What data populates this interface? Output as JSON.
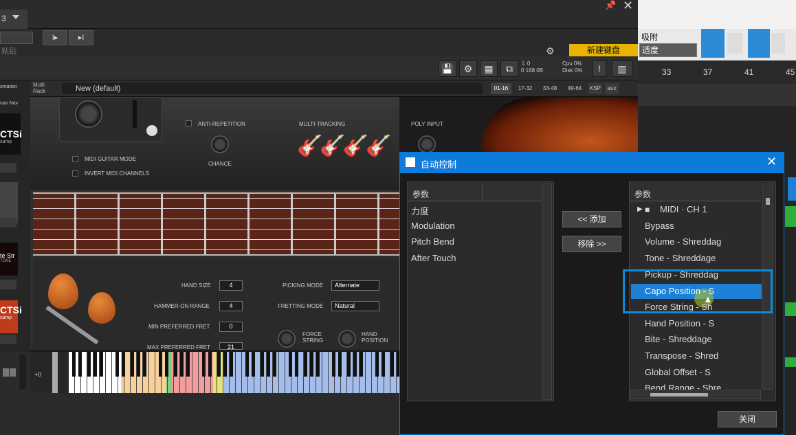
{
  "top": {
    "track_num": "3",
    "paste": "粘贴"
  },
  "toolbar": {
    "new_keyboard": "新建键盘",
    "btn1": "I▸",
    "btn2": "▸I"
  },
  "snap": {
    "label": "吸附",
    "value": "适度"
  },
  "ruler": [
    "33",
    "37",
    "41",
    "45"
  ],
  "kontakt": {
    "mem_line1": "⇩ 0",
    "mem_line2": "0 168 0B",
    "cpu_line1": "Cpu  0%",
    "cpu_line2": "Disk 0%",
    "multi_line1": "Multi",
    "multi_line2": "Rack",
    "preset": "New (default)",
    "ranges": [
      "01-16",
      "17-32",
      "33-48",
      "49-64",
      "KSP",
      "aux"
    ]
  },
  "leftstrip": {
    "automation": "omation",
    "instr": "nstr Nav",
    "ctsi1": "CTSi",
    "samp1": "samp",
    "ctsi2": "te Str",
    "tone": "TONE",
    "ctsi3": "CTSi",
    "samp3": "samp"
  },
  "instrument": {
    "midi_guitar_mode": "MIDI GUITAR MODE",
    "invert_midi": "INVERT MIDI CHANNELS",
    "anti_repetition": "ANTI-REPETITION",
    "chance": "CHANCE",
    "multi_tracking": "MULTI-TRACKING",
    "poly_input": "POLY INPUT",
    "hand_size_label": "HAND SIZE",
    "hand_size": "4",
    "hammer_on_label": "HAMMER-ON RANGE",
    "hammer_on": "4",
    "min_fret_label": "MIN PREFERRED FRET",
    "min_fret": "0",
    "max_fret_label": "MAX PREFERRED FRET",
    "max_fret": "21",
    "picking_mode_label": "PICKING MODE",
    "picking_mode": "Alternate",
    "fretting_mode_label": "FRETTING MODE",
    "fretting_mode": "Natural",
    "force_string": "FORCE\nSTRING",
    "hand_position": "HAND\nPOSITION",
    "octave": "+0"
  },
  "dialog": {
    "title": "自动控制",
    "left_header": "参数",
    "left_items": [
      "力度",
      "Modulation",
      "Pitch Bend",
      "After Touch"
    ],
    "add_button": "<< 添加",
    "remove_button": "移除 >>",
    "right_header": "参数",
    "folder": "MIDI · CH 1",
    "right_items": [
      "Bypass",
      "Volume - Shreddag",
      "Tone - Shreddage",
      "Pickup - Shreddag",
      "Capo Position - S",
      "Force String - Sh",
      "Hand Position - S",
      "Bite - Shreddage",
      "Transpose - Shred",
      "Global Offset - S",
      "Bend Range - Shre"
    ],
    "close_button": "关闭"
  },
  "colors": {
    "accent": "#0e7ad9",
    "highlight": "#0a8cde",
    "newkb": "#e8b400"
  }
}
